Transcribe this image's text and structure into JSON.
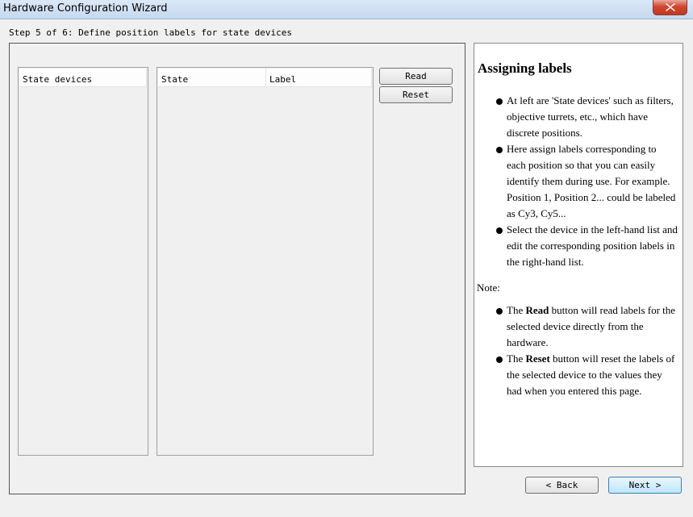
{
  "window": {
    "title": "Hardware Configuration Wizard",
    "close_symbol": "✕"
  },
  "wizard": {
    "step_label": "Step 5 of 6: Define position labels for state devices"
  },
  "devices_list": {
    "header": "State devices",
    "items": []
  },
  "labels_table": {
    "columns": [
      "State",
      "Label"
    ],
    "rows": []
  },
  "buttons": {
    "read": "Read",
    "reset": "Reset",
    "back": "< Back",
    "next": "Next >"
  },
  "help": {
    "title": "Assigning labels",
    "bullets": [
      "At left are 'State devices' such as filters, objective turrets, etc., which have discrete positions.",
      "Here assign labels corresponding to each position so that you can easily identify them during use. For example. Position 1, Position 2... could be labeled as Cy3, Cy5...",
      "Select the device in the left-hand list and edit the corresponding position labels in the right-hand list."
    ],
    "note_label": "Note:",
    "notes": [
      {
        "prefix": "The ",
        "bold": "Read",
        "suffix": " button will read labels for the selected device directly from the hardware."
      },
      {
        "prefix": "The ",
        "bold": "Reset",
        "suffix": " button will reset the labels of the selected device to the values they had when you entered this page."
      }
    ]
  }
}
